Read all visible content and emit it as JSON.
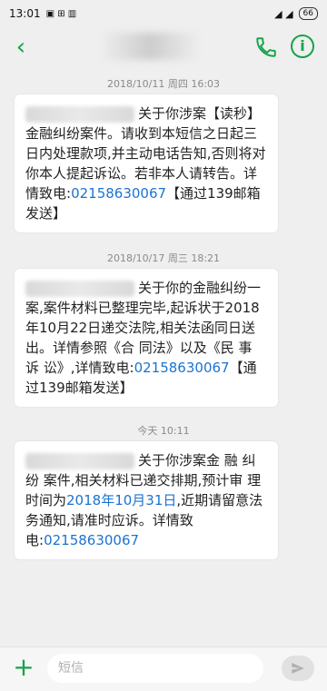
{
  "status": {
    "time": "13:01",
    "battery": "66"
  },
  "messages": [
    {
      "timestamp": "2018/10/11 周四 16:03",
      "prefix": "关于你",
      "text": "涉案【读秒】金融纠纷案件。请收到本短信之日起三日内处理款项,并主动电话告知,否则将对你本人提起诉讼。若非本人请转告。详情致电:",
      "phone": "02158630067",
      "suffix": "【通过139邮箱发送】"
    },
    {
      "timestamp": "2018/10/17 周三 18:21",
      "prefix": "关于你的",
      "text": "金融纠纷一案,案件材料已整理完毕,起诉状于2018年10月22日递交法院,相关法函同日送出。详情参照《合 同法》以及《民 事 诉 讼》,详情致电:",
      "phone": "02158630067",
      "suffix": "【通过139邮箱发送】"
    },
    {
      "timestamp": "今天 10:11",
      "prefix": "关于你涉",
      "text1": "案金 融 纠 纷 案件,相关材料已递交排期,预计审 理时间为",
      "date_link": "2018年10月31日",
      "text2": ",近期请留意法 务通知,请准时应诉。详情致电:",
      "phone": "02158630067"
    }
  ],
  "compose": {
    "placeholder": "短信"
  },
  "colors": {
    "accent": "#17a34a",
    "link": "#1b73d1"
  }
}
